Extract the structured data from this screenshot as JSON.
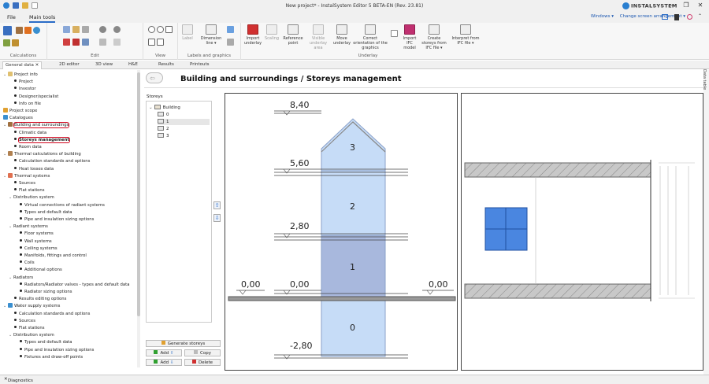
{
  "window": {
    "title": "New project* - InstalSystem Editor 5 BETA-EN (Rev. 23.81)",
    "brand": "INSTALSYSTEM"
  },
  "menu": {
    "file": "File",
    "main_tools": "Main tools",
    "windows": "Windows ▾",
    "change_arrangement": "Change screen arrangement ▾"
  },
  "ribbon": {
    "groups": {
      "calculations": "Calculations",
      "edit": "Edit",
      "view": "View",
      "labels": "Labels and graphics",
      "underlay": "Underlay"
    },
    "label": "Label",
    "dimension_line": "Dimension line ▾",
    "import_underlay": "Import underlay",
    "scaling": "Scaling",
    "reference_point": "Reference point",
    "visible_underlay": "Visible underlay area",
    "move_underlay": "Move underlay",
    "correct_orientation": "Correct orientation of the graphics",
    "import_ifc": "Import IFC model",
    "create_storeys": "Create storeys from IFC file ▾",
    "interpret_ifc": "Interpret from IFC file ▾"
  },
  "tabs": [
    "General data",
    "2D editor",
    "3D view",
    "H&E",
    "Results",
    "Printouts"
  ],
  "tree": {
    "project_info": "Project info",
    "project": "Project",
    "investor": "Investor",
    "designer": "Designer/specialist",
    "info_on_file": "Info on file",
    "project_scope": "Project scope",
    "catalogues": "Catalogues",
    "building": "Building and surroundings",
    "climatic": "Climatic data",
    "storeys_mgmt": "Storeys management",
    "room_data": "Room data",
    "thermal_calc": "Thermal calculations of building",
    "calc_standards": "Calculation standards and options",
    "heat_losses": "Heat losses data",
    "thermal_systems": "Thermal systems",
    "sources": "Sources",
    "flat_stations": "Flat stations",
    "distribution": "Distribution system",
    "virtual_conn": "Virtual connections of radiant systems",
    "types_default": "Types and default data",
    "pipe_sizing": "Pipe and insulation sizing options",
    "radiant_systems": "Radiant systems",
    "floor_systems": "Floor systems",
    "wall_systems": "Wall systems",
    "ceiling_systems": "Ceiling systems",
    "manifolds": "Manifolds, fittings and control",
    "coils": "Coils",
    "additional": "Additional options",
    "radiators": "Radiators",
    "radiator_valves": "Radiators/Radiator valves - types and default data",
    "radiator_sizing": "Radiator sizing options",
    "results_editing": "Results editing options",
    "water_supply": "Water supply systems",
    "ws_calc_standards": "Calculation standards and options",
    "ws_sources": "Sources",
    "ws_flat_stations": "Flat stations",
    "ws_distribution": "Distribution system",
    "ws_types_default": "Types and default data",
    "ws_pipe_sizing": "Pipe and insulation sizing options",
    "fixtures": "Fixtures and draw-off points"
  },
  "panel": {
    "title": "Building and surroundings / Storeys management",
    "storeys_label": "Storeys",
    "building": "Building",
    "storeys": [
      "0",
      "1",
      "2",
      "3"
    ],
    "selected_storey": "1",
    "generate_storeys": "Generate storeys",
    "add_up": "Add",
    "copy": "Copy",
    "add_down": "Add",
    "delete": "Delete"
  },
  "drawing": {
    "levels": [
      "8,40",
      "5,60",
      "2,80",
      "0,00",
      "0,00",
      "0,00",
      "-2,80"
    ],
    "storey_numbers": [
      "3",
      "2",
      "1",
      "0"
    ]
  },
  "bottom": {
    "diagnostics": "Diagnostics"
  },
  "side": {
    "data_table": "Data table"
  },
  "colors": {
    "accent": "#2a6cc7",
    "storey_fill": "#c6dcf7",
    "storey_selected": "#a8b8dd",
    "highlight": "#d0021b",
    "window_blue": "#4a86e0"
  }
}
